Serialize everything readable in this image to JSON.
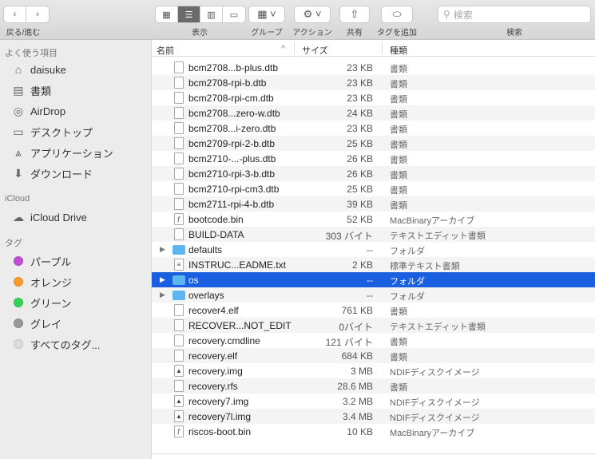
{
  "toolbar": {
    "back_forward_label": "戻る/進む",
    "view_label": "表示",
    "group_label": "グループ",
    "action_label": "アクション",
    "share_label": "共有",
    "tag_label": "タグを追加",
    "search_label": "検索",
    "search_placeholder": "検索"
  },
  "sidebar": {
    "favorites_header": "よく使う項目",
    "favorites": [
      {
        "label": "daisuke",
        "icon": "home-icon"
      },
      {
        "label": "書類",
        "icon": "documents-icon"
      },
      {
        "label": "AirDrop",
        "icon": "airdrop-icon"
      },
      {
        "label": "デスクトップ",
        "icon": "desktop-icon"
      },
      {
        "label": "アプリケーション",
        "icon": "applications-icon"
      },
      {
        "label": "ダウンロード",
        "icon": "downloads-icon"
      }
    ],
    "icloud_header": "iCloud",
    "icloud": [
      {
        "label": "iCloud Drive",
        "icon": "cloud-icon"
      }
    ],
    "tags_header": "タグ",
    "tags": [
      {
        "label": "パープル",
        "color": "#bf4fd6"
      },
      {
        "label": "オレンジ",
        "color": "#fd9a2e"
      },
      {
        "label": "グリーン",
        "color": "#33d157"
      },
      {
        "label": "グレイ",
        "color": "#98989d"
      },
      {
        "label": "すべてのタグ...",
        "color": "#dddddd"
      }
    ]
  },
  "columns": {
    "name": "名前",
    "size": "サイズ",
    "kind": "種類"
  },
  "files": [
    {
      "name": "bcm2708...b-plus.dtb",
      "size": "23 KB",
      "kind": "書類",
      "type": "file"
    },
    {
      "name": "bcm2708-rpi-b.dtb",
      "size": "23 KB",
      "kind": "書類",
      "type": "file"
    },
    {
      "name": "bcm2708-rpi-cm.dtb",
      "size": "23 KB",
      "kind": "書類",
      "type": "file"
    },
    {
      "name": "bcm2708...zero-w.dtb",
      "size": "24 KB",
      "kind": "書類",
      "type": "file"
    },
    {
      "name": "bcm2708...i-zero.dtb",
      "size": "23 KB",
      "kind": "書類",
      "type": "file"
    },
    {
      "name": "bcm2709-rpi-2-b.dtb",
      "size": "25 KB",
      "kind": "書類",
      "type": "file"
    },
    {
      "name": "bcm2710-...-plus.dtb",
      "size": "26 KB",
      "kind": "書類",
      "type": "file"
    },
    {
      "name": "bcm2710-rpi-3-b.dtb",
      "size": "26 KB",
      "kind": "書類",
      "type": "file"
    },
    {
      "name": "bcm2710-rpi-cm3.dtb",
      "size": "25 KB",
      "kind": "書類",
      "type": "file"
    },
    {
      "name": "bcm2711-rpi-4-b.dtb",
      "size": "39 KB",
      "kind": "書類",
      "type": "file"
    },
    {
      "name": "bootcode.bin",
      "size": "52 KB",
      "kind": "MacBinaryアーカイブ",
      "type": "bin"
    },
    {
      "name": "BUILD-DATA",
      "size": "303 バイト",
      "kind": "テキストエディット書類",
      "type": "file"
    },
    {
      "name": "defaults",
      "size": "--",
      "kind": "フォルダ",
      "type": "folder"
    },
    {
      "name": "INSTRUC...EADME.txt",
      "size": "2 KB",
      "kind": "標準テキスト書類",
      "type": "txt"
    },
    {
      "name": "os",
      "size": "--",
      "kind": "フォルダ",
      "type": "folder",
      "selected": true
    },
    {
      "name": "overlays",
      "size": "--",
      "kind": "フォルダ",
      "type": "folder"
    },
    {
      "name": "recover4.elf",
      "size": "761 KB",
      "kind": "書類",
      "type": "file"
    },
    {
      "name": "RECOVER...NOT_EDIT",
      "size": "0バイト",
      "kind": "テキストエディット書類",
      "type": "file"
    },
    {
      "name": "recovery.cmdline",
      "size": "121 バイト",
      "kind": "書類",
      "type": "file"
    },
    {
      "name": "recovery.elf",
      "size": "684 KB",
      "kind": "書類",
      "type": "file"
    },
    {
      "name": "recovery.img",
      "size": "3 MB",
      "kind": "NDIFディスクイメージ",
      "type": "img"
    },
    {
      "name": "recovery.rfs",
      "size": "28.6 MB",
      "kind": "書類",
      "type": "file"
    },
    {
      "name": "recovery7.img",
      "size": "3.2 MB",
      "kind": "NDIFディスクイメージ",
      "type": "img"
    },
    {
      "name": "recovery7l.img",
      "size": "3.4 MB",
      "kind": "NDIFディスクイメージ",
      "type": "img"
    },
    {
      "name": "riscos-boot.bin",
      "size": "10 KB",
      "kind": "MacBinaryアーカイブ",
      "type": "bin"
    }
  ]
}
